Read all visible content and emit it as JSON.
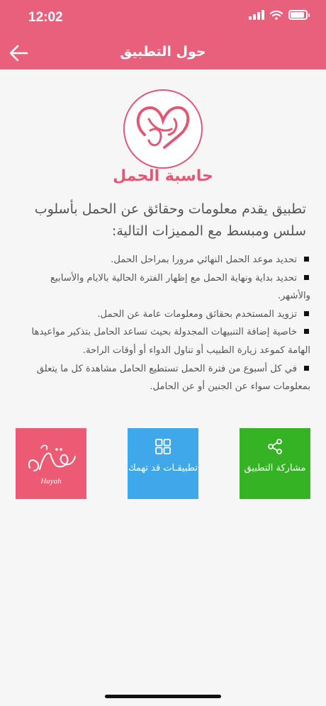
{
  "status_bar": {
    "time": "12:02",
    "battery_level": 0.9
  },
  "header": {
    "title": "حول التطبيق",
    "back_icon": "arrow-left-icon"
  },
  "colors": {
    "brand": "#e8607b",
    "share_tile": "#35b324",
    "apps_tile": "#3fa8ea",
    "hayah_tile": "#ec5a73"
  },
  "app": {
    "name": "حاسبة الحمل",
    "logo_icon": "heart-embrace-logo"
  },
  "intro": "تطبيق يقدم معلومات وحقائق عن الحمل بأسلوب سلس ومبسط مع المميزات التالية:",
  "features": [
    "تحديد موعد الحمل النهائي مرورا بمراحل الحمل.",
    "تحديد بداية ونهاية الحمل مع إظهار الفترة الحالية بالايام والأسابيع والأشهر.",
    "تزويد المستخدم بحقائق ومعلومات عامة عن الحمل.",
    "خاصية إضافة التنبيهات المجدولة بحيث تساعد الحامل بتذكير مواعيدها الهامة كموعد زيارة الطبيب أو تناول الدواء أو أوقات الراحة.",
    "في كل أسبوع من فترة الحمل تستطيع الحامل مشاهدة كل ما يتعلق بمعلومات سواء عن الجنين أو عن الحامل."
  ],
  "tiles": {
    "share": {
      "label": "مشاركة التطبيق",
      "icon": "share-icon"
    },
    "apps": {
      "label": "تطبيقـات قد تهمك",
      "icon": "grid-icon"
    },
    "hayah": {
      "logo_text": "Hayah",
      "icon": "hayah-logo"
    }
  }
}
